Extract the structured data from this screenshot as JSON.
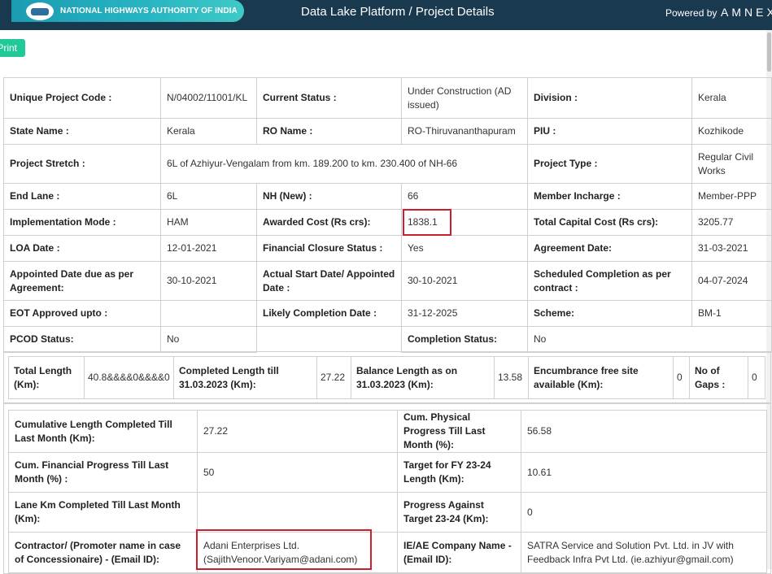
{
  "header": {
    "org_name": "NATIONAL HIGHWAYS AUTHORITY OF INDIA",
    "title": "Data Lake Platform / Project Details",
    "powered_by": "Powered by",
    "brand": "AMNEX"
  },
  "toolbar": {
    "print_label": "Print"
  },
  "colors": {
    "header_bg": "#19394f",
    "logo_gradient": "#26b3c2",
    "print_button": "#20c997",
    "highlight": "#cc1f2e"
  },
  "details": {
    "r1": {
      "l1": "Unique Project Code :",
      "v1": "N/04002/11001/KL",
      "l2": "Current Status :",
      "v2": "Under Construction (AD issued)",
      "l3": "Division :",
      "v3": "Kerala"
    },
    "r2": {
      "l1": "State Name :",
      "v1": "Kerala",
      "l2": "RO Name :",
      "v2": "RO-Thiruvananthapuram",
      "l3": "PIU :",
      "v3": "Kozhikode"
    },
    "r3": {
      "l1": "Project Stretch :",
      "v1": "6L of Azhiyur-Vengalam from km. 189.200 to km. 230.400 of NH-66",
      "l3": "Project Type :",
      "v3": "Regular Civil Works"
    },
    "r4": {
      "l1": "End Lane :",
      "v1": "6L",
      "l2": "NH (New) :",
      "v2": "66",
      "l3": "Member Incharge :",
      "v3": "Member-PPP"
    },
    "r5": {
      "l1": "Implementation Mode :",
      "v1": "HAM",
      "l2": "Awarded Cost (Rs crs):",
      "v2": "1838.1",
      "l3": "Total Capital Cost (Rs crs):",
      "v3": "3205.77"
    },
    "r6": {
      "l1": "LOA Date :",
      "v1": "12-01-2021",
      "l2": "Financial Closure Status :",
      "v2": "Yes",
      "l3": "Agreement Date:",
      "v3": "31-03-2021"
    },
    "r7": {
      "l1": "Appointed Date due as per Agreement:",
      "v1": "30-10-2021",
      "l2": "Actual Start Date/ Appointed Date :",
      "v2": "30-10-2021",
      "l3": "Scheduled Completion as per contract :",
      "v3": "04-07-2024"
    },
    "r8": {
      "l1": "EOT Approved upto :",
      "v1": "",
      "l2": "Likely Completion Date :",
      "v2": "31-12-2025",
      "l3": "Scheme:",
      "v3": "BM-1"
    },
    "r9": {
      "l1": "PCOD Status:",
      "v1": "No",
      "l2": "Completion Status:",
      "v2": "No"
    }
  },
  "length_summary": {
    "l1": "Total Length (Km):",
    "v1": "40.8&&&&0&&&&0",
    "l2": "Completed Length till 31.03.2023 (Km):",
    "v2": "27.22",
    "l3": "Balance Length as on 31.03.2023 (Km):",
    "v3": "13.58",
    "l4": "Encumbrance free site available (Km):",
    "v4": "0",
    "l5": "No of Gaps :",
    "v5": "0"
  },
  "progress": {
    "r1": {
      "l1": "Cumulative Length Completed Till Last Month (Km):",
      "v1": "27.22",
      "l2": "Cum. Physical Progress Till Last Month (%):",
      "v2": "56.58"
    },
    "r2": {
      "l1": "Cum. Financial Progress Till Last Month (%) :",
      "v1": "50",
      "l2": "Target for FY 23-24 Length (Km):",
      "v2": "10.61"
    },
    "r3": {
      "l1": "Lane Km Completed Till Last Month (Km):",
      "v1": "",
      "l2": "Progress Against Target 23-24 (Km):",
      "v2": "0"
    },
    "r4": {
      "l1": "Contractor/ (Promoter name in case of Concessionaire) - (Email ID):",
      "v1": "Adani Enterprises Ltd. (SajithVenoor.Variyam@adani.com)",
      "l2": "IE/AE Company Name - (Email ID):",
      "v2": "SATRA Service and Solution Pvt. Ltd. in JV with Feedback Infra Pvt Ltd. (ie.azhiyur@gmail.com)"
    }
  }
}
